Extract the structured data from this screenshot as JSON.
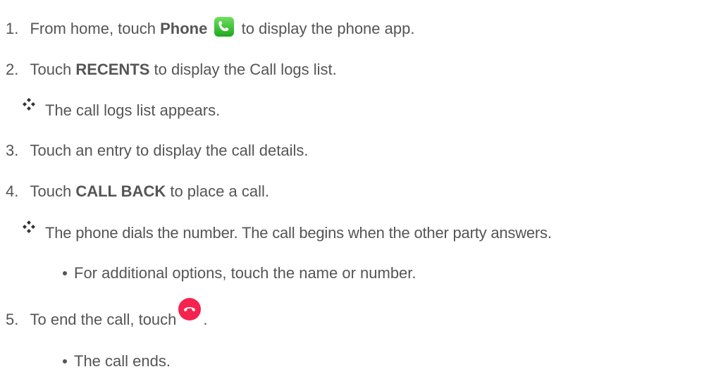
{
  "steps": [
    {
      "num": "1.",
      "pre": "From home, touch ",
      "bold": "Phone",
      "post": " to display the phone app."
    },
    {
      "num": "2.",
      "pre": "Touch ",
      "bold": "RECENTS",
      "post": " to display the Call logs list."
    },
    {
      "num": "3.",
      "text": "Touch an entry to display the call details."
    },
    {
      "num": "4.",
      "pre": "Touch ",
      "bold": "CALL BACK",
      "post": " to place a call."
    },
    {
      "num": "5.",
      "pre": "To end the call, touch",
      "post": "."
    }
  ],
  "results": [
    "The call logs list appears.",
    "The phone dials the number. The call begins when the other party answers."
  ],
  "bullets": [
    "For additional options, touch the name or number.",
    "The call ends."
  ],
  "icons": {
    "phone": "phone-app-icon",
    "end_call": "end-call-icon",
    "result_marker": "four-diamond-icon",
    "bullet": "bullet-dot"
  },
  "colors": {
    "text": "#555555",
    "phone_green": "#2bbb2b",
    "end_call_red": "#f5234e"
  }
}
